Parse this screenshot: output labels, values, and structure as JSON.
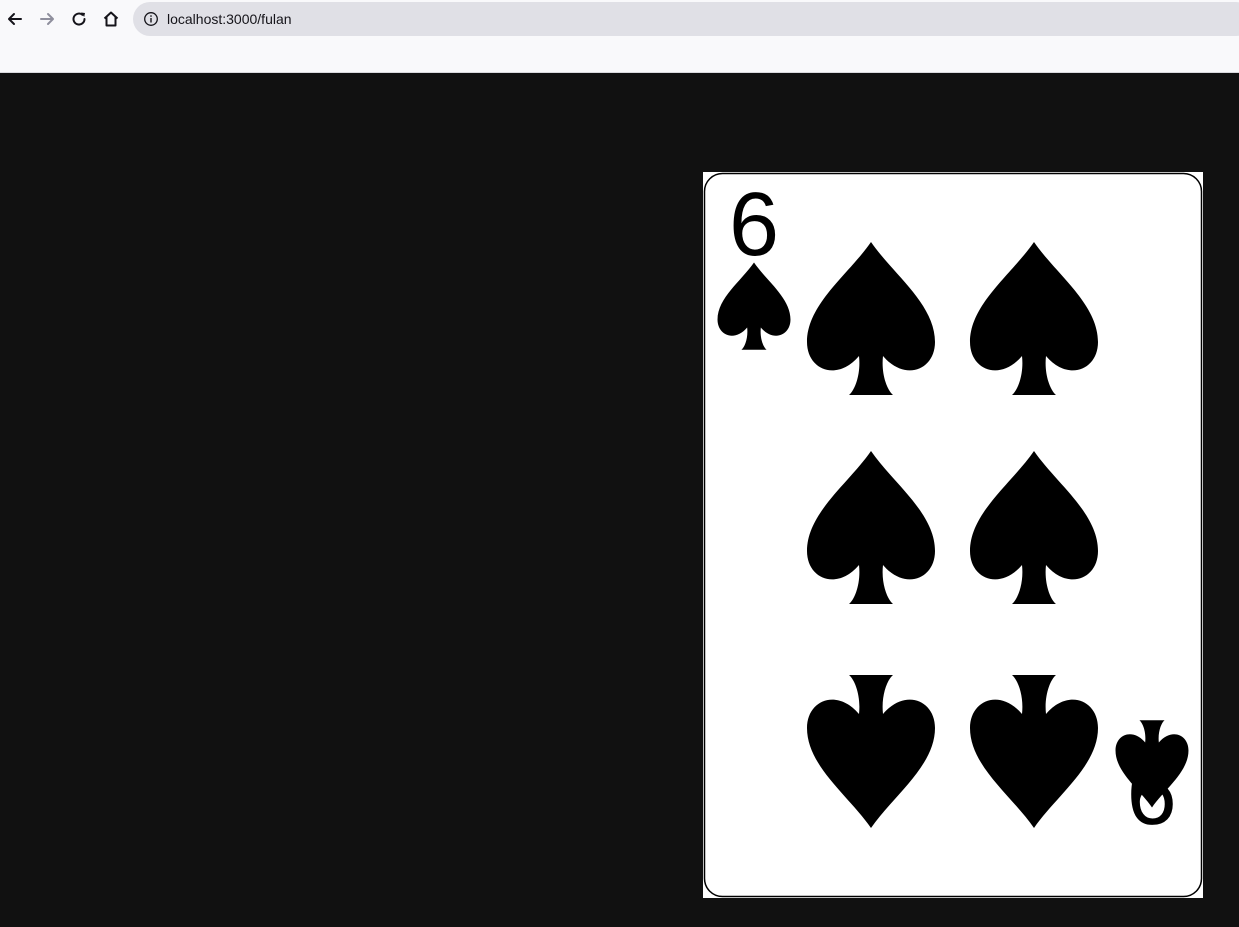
{
  "browser": {
    "url": "localhost:3000/fulan",
    "icons": [
      "back-arrow-icon",
      "forward-arrow-icon",
      "reload-icon",
      "home-icon",
      "info-icon"
    ]
  },
  "page": {
    "background": "#111111"
  },
  "card": {
    "corner_top_rank": "6",
    "corner_bottom_rank": "9",
    "suit": "spades",
    "suit_color": "#000000",
    "face_color": "#ffffff",
    "pips": 6
  }
}
